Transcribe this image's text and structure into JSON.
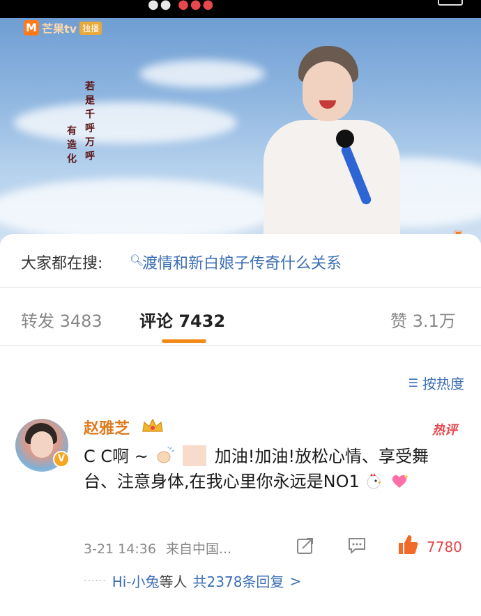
{
  "search": {
    "label": "大家都在搜:",
    "query": "渡情和新白娘子传奇什么关系"
  },
  "tabs": [
    {
      "label": "转发 3483",
      "active": false
    },
    {
      "label": "评论 7432",
      "active": true
    },
    {
      "label": "赞 3.1万",
      "active": false
    }
  ],
  "sort": {
    "label": "按热度",
    "icon": "sort-icon"
  },
  "comment": {
    "username": "赵雅芝",
    "hot_badge": "热评",
    "text_prefix": "C C啊 ~",
    "text_main": "加油!加油!放松心情、享受舞台、注意身体,在我心里你永远是NO1",
    "timestamp": "3-21 14:36",
    "source": "来自中国...",
    "like_count": "7780",
    "replies_summary_name": "Hi-小兔",
    "replies_summary_mid": "等人",
    "replies_summary_count": "共2378条回复",
    "replies_arrow": ">"
  },
  "video": {
    "logo_text": "芒果tv",
    "logo_badge": "独播"
  },
  "colors": {
    "accent_orange": "#f28a1a",
    "link_blue": "#3c6fb4",
    "like_red": "#e5484d",
    "username_orange": "#e07a1f"
  }
}
